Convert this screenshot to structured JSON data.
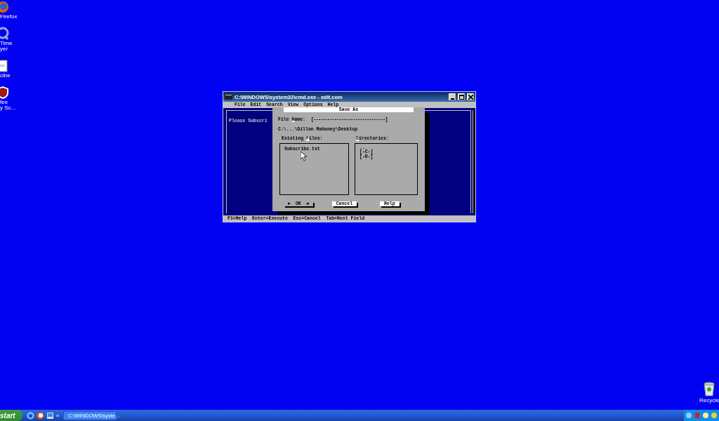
{
  "desktop_icons": [
    {
      "kind": "firefox",
      "lines": [
        "Firefox"
      ]
    },
    {
      "kind": "quicktime",
      "lines": [
        "Time",
        "yer"
      ]
    },
    {
      "kind": "document",
      "lines": [
        "cibe"
      ]
    },
    {
      "kind": "shield",
      "lines": [
        "fee",
        "y Sc..."
      ]
    }
  ],
  "recycle_bin": {
    "label": "Recycle"
  },
  "window": {
    "title": "C:\\WINDOWS\\system32\\cmd.exe - edit.com",
    "menu": [
      "File",
      "Edit",
      "Search",
      "View",
      "Options",
      "Help"
    ],
    "editor_text": "Please Subscri",
    "status_bar": "F1=Help  Enter=Execute  Esc=Cancel  Tab=Next Field"
  },
  "dialog": {
    "title": "Save As",
    "file_name_label": [
      {
        "text": "File ",
        "hotkey": false
      },
      {
        "text": "N",
        "hotkey": true
      },
      {
        "text": "ame:",
        "hotkey": false
      }
    ],
    "file_name_value": "[-------------------------------]",
    "path": "C:\\...\\Dillon Mahoney\\Desktop",
    "files_label": [
      {
        "text": "Existing ",
        "hotkey": false
      },
      {
        "text": "F",
        "hotkey": true
      },
      {
        "text": "iles:",
        "hotkey": false
      }
    ],
    "dirs_label": [
      {
        "text": "D",
        "hotkey": true
      },
      {
        "text": "irectories:",
        "hotkey": false
      }
    ],
    "files": [
      "Subscribe.txt"
    ],
    "directories": [
      "..",
      "[-C-]",
      "[-D-]"
    ],
    "buttons": [
      {
        "before": "►",
        "label": "OK",
        "after": "◄",
        "selected": true
      },
      {
        "label": "Cancel",
        "selected": false
      },
      {
        "label": "Help",
        "selected": false
      }
    ]
  },
  "taskbar": {
    "start": "start",
    "overflow": "»",
    "tasks": [
      {
        "label": "C:\\WINDOWS\\syste...",
        "selected": false
      }
    ]
  }
}
